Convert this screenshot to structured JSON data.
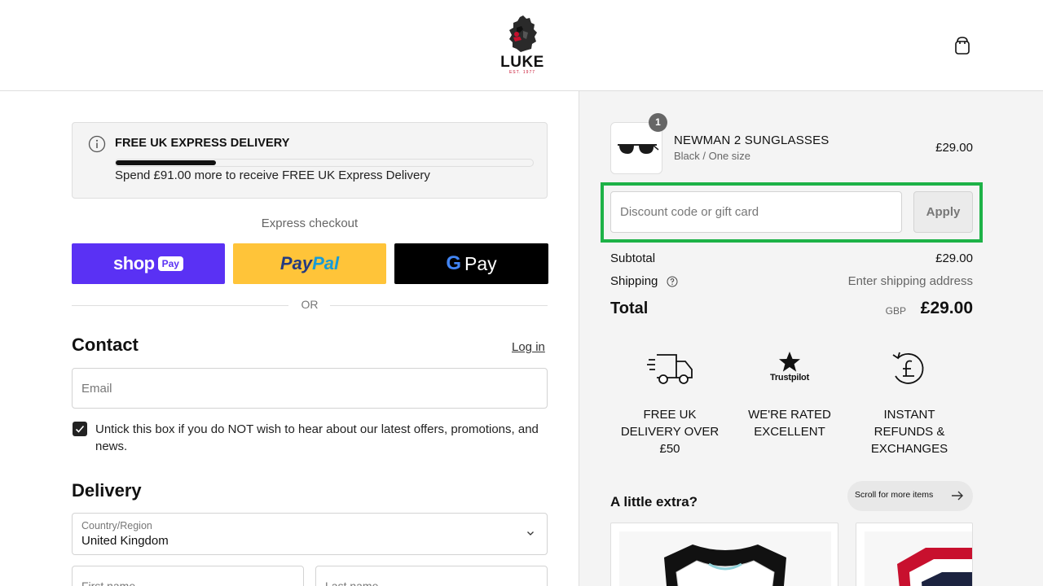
{
  "header": {
    "logo_text": "LUKE",
    "logo_est": "EST. 1977"
  },
  "banner": {
    "title": "FREE UK EXPRESS DELIVERY",
    "progress_fraction": 0.24,
    "text": "Spend £91.00 more to receive FREE UK Express Delivery"
  },
  "express": {
    "label": "Express checkout",
    "shop_text": "shop",
    "shop_badge": "Pay",
    "paypal_text_1": "Pay",
    "paypal_text_2": "Pal",
    "gpay_g": "G",
    "gpay_text": "Pay",
    "or_text": "OR"
  },
  "contact": {
    "title": "Contact",
    "login_label": "Log in",
    "email_placeholder": "Email",
    "marketing_checked": true,
    "marketing_label": "Untick this box if you do NOT wish to hear about our latest offers, promotions, and news."
  },
  "delivery": {
    "title": "Delivery",
    "country_label": "Country/Region",
    "country_value": "United Kingdom",
    "first_name_placeholder": "First name",
    "last_name_placeholder": "Last name"
  },
  "order": {
    "item": {
      "quantity": "1",
      "name": "NEWMAN 2 SUNGLASSES",
      "variant": "Black / One size",
      "price": "£29.00"
    },
    "discount_placeholder": "Discount code or gift card",
    "apply_label": "Apply",
    "subtotal_label": "Subtotal",
    "subtotal_value": "£29.00",
    "shipping_label": "Shipping",
    "shipping_value": "Enter shipping address",
    "total_label": "Total",
    "total_currency": "GBP",
    "total_value": "£29.00"
  },
  "perks": [
    {
      "icon": "delivery-truck-icon",
      "text_line_1": "FREE UK",
      "text_line_2": "DELIVERY OVER",
      "text_line_3": "£50"
    },
    {
      "icon": "trustpilot-star-icon",
      "icon_text": "Trustpilot",
      "text_line_1": "WE'RE RATED",
      "text_line_2": "EXCELLENT"
    },
    {
      "icon": "pound-refund-icon",
      "text_line_1": "INSTANT",
      "text_line_2": "REFUNDS &",
      "text_line_3": "EXCHANGES"
    }
  ],
  "upsell": {
    "title": "A little extra?",
    "scroll_label": "Scroll for more items"
  },
  "colors": {
    "shop_pay": "#5a31f4",
    "paypal": "#ffc439",
    "gpay": "#000000",
    "highlight": "#1db247"
  }
}
